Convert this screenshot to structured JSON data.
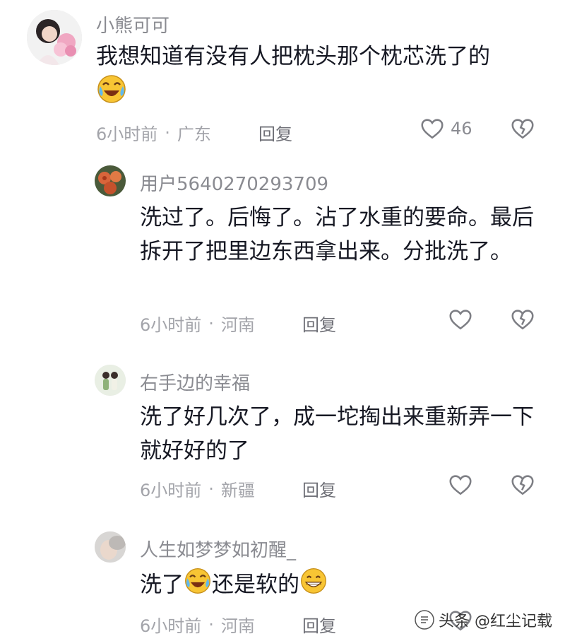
{
  "comments": [
    {
      "username": "小熊可可",
      "text": "我想知道有没有人把枕头那个枕芯洗了的",
      "time": "6小时前",
      "location": "广东",
      "reply_label": "回复",
      "like_count": "46",
      "avatar_icon": "avatar-girl-with-flowers"
    },
    {
      "username": "用户5640270293709",
      "text": "洗过了。后悔了。沾了水重的要命。最后拆开了把里边东西拿出来。分批洗了。",
      "time": "6小时前",
      "location": "河南",
      "reply_label": "回复",
      "like_count": "",
      "avatar_icon": "avatar-roses"
    },
    {
      "username": "右手边的幸福",
      "text": "洗了好几次了，成一坨掏出来重新弄一下就好好的了",
      "time": "6小时前",
      "location": "新疆",
      "reply_label": "回复",
      "like_count": "",
      "avatar_icon": "avatar-couple"
    },
    {
      "username": "人生如梦梦如初醒_",
      "text_part1": "洗了",
      "text_part2": "还是软的",
      "time": "6小时前",
      "location": "河南",
      "reply_label": "回复",
      "like_count": "",
      "avatar_icon": "avatar-person"
    }
  ],
  "watermark": "头条 @红尘记载",
  "colors": {
    "text": "#161823",
    "meta": "#a3a4aa",
    "username": "#8a8b91"
  }
}
